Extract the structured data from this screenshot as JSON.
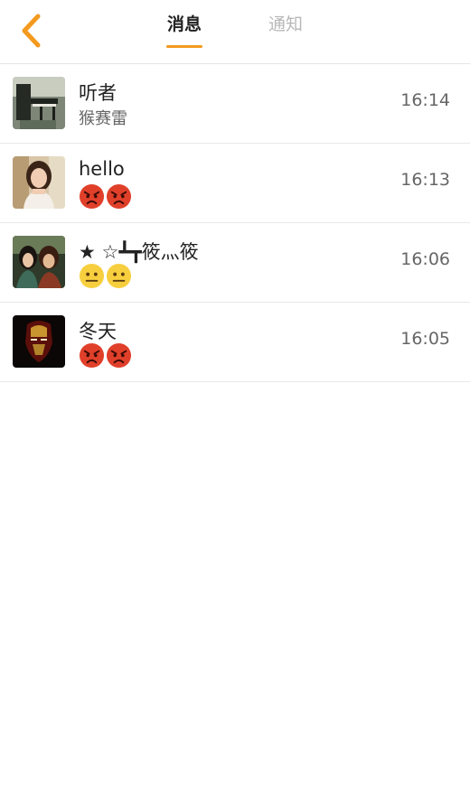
{
  "header": {
    "back_icon": "chevron-left-icon",
    "accent_color": "#f39a1e",
    "tabs": [
      {
        "label": "消息",
        "active": true
      },
      {
        "label": "通知",
        "active": false
      }
    ]
  },
  "conversations": [
    {
      "name": "听者",
      "preview_text": "猴赛雷",
      "time": "16:14",
      "avatar": "piano-photo",
      "emoji": []
    },
    {
      "name": "hello",
      "preview_text": "",
      "time": "16:13",
      "avatar": "woman-portrait",
      "emoji": [
        "angry-face-emoji",
        "angry-face-emoji"
      ]
    },
    {
      "name": "★ ☆┻┳筱灬筱",
      "preview_text": "",
      "time": "16:06",
      "avatar": "game-characters",
      "emoji": [
        "neutral-face-emoji",
        "neutral-face-emoji"
      ]
    },
    {
      "name": "冬天",
      "preview_text": "",
      "time": "16:05",
      "avatar": "iron-man-helmet",
      "emoji": [
        "angry-face-emoji",
        "angry-face-emoji"
      ]
    }
  ]
}
